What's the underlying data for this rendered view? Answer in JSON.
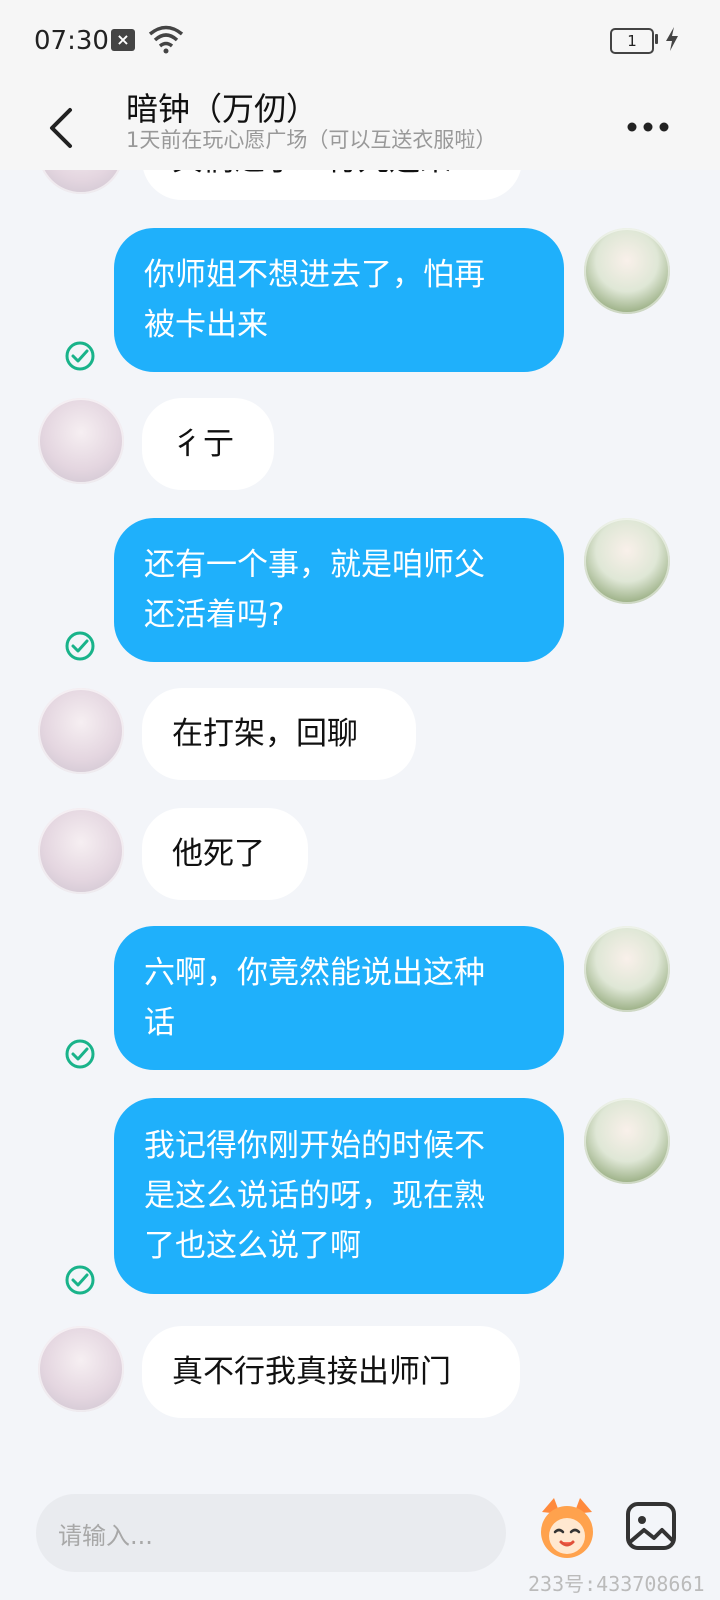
{
  "status": {
    "time": "07:30",
    "battery": "1"
  },
  "header": {
    "title": "暗钟（万仞）",
    "subtitle": "1天前在玩心愿广场（可以互送衣服啦）"
  },
  "messages": [
    {
      "side": "in",
      "text": "其们之了一行九运来",
      "partial": true
    },
    {
      "side": "out",
      "lines": [
        "你师姐不想进去了，怕再",
        "被卡出来"
      ]
    },
    {
      "side": "in",
      "text": "彳亍"
    },
    {
      "side": "out",
      "lines": [
        "还有一个事，就是咱师父",
        "还活着吗?"
      ]
    },
    {
      "side": "in",
      "text": "在打架，回聊"
    },
    {
      "side": "in",
      "text": "他死了"
    },
    {
      "side": "out",
      "lines": [
        "六啊，你竟然能说出这种",
        "话"
      ]
    },
    {
      "side": "out",
      "lines": [
        "我记得你刚开始的时候不",
        "是这么说话的呀，现在熟",
        "了也这么说了啊"
      ]
    },
    {
      "side": "in",
      "text": "真不行我真接出师门"
    }
  ],
  "input": {
    "placeholder": "请输入..."
  },
  "watermark": "233号:433708661",
  "colors": {
    "outgoing_bubble": "#1fb0fb",
    "check": "#19b38a"
  }
}
